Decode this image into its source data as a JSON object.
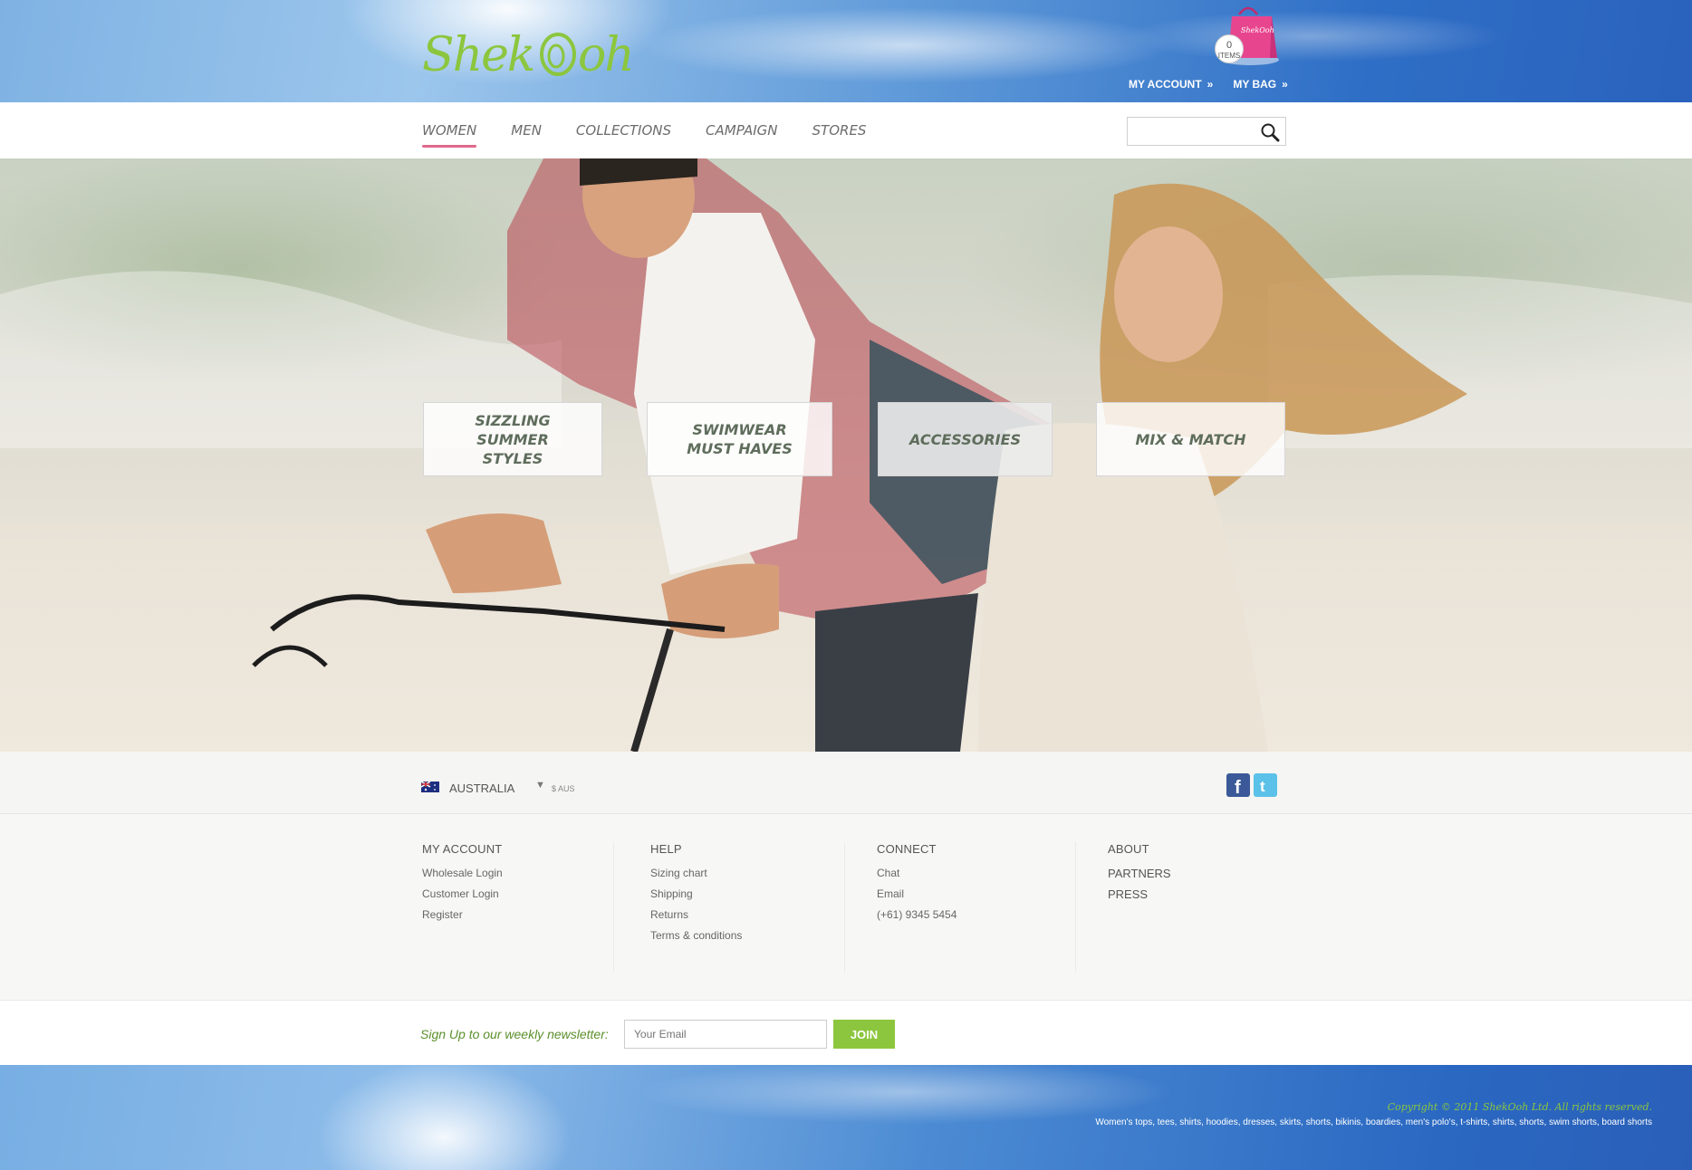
{
  "brand": {
    "logo_text": "ShekOoh"
  },
  "bag": {
    "count": "0",
    "unit": "ITEMS"
  },
  "top_links": {
    "my_account": "MY ACCOUNT",
    "my_bag": "MY BAG",
    "arrow": "»"
  },
  "nav": {
    "items": [
      "WOMEN",
      "MEN",
      "COLLECTIONS",
      "CAMPAIGN",
      "STORES"
    ],
    "active": "WOMEN"
  },
  "search": {
    "placeholder": ""
  },
  "categories": [
    "SIZZLING SUMMER STYLES",
    "SWIMWEAR MUST HAVES",
    "ACCESSORIES",
    "MIX & MATCH"
  ],
  "region": {
    "country": "AUSTRALIA",
    "currency": "$ AUS"
  },
  "footer": {
    "my_account": {
      "title": "MY ACCOUNT",
      "links": [
        "Wholesale Login",
        "Customer Login",
        "Register"
      ]
    },
    "help": {
      "title": "HELP",
      "links": [
        "Sizing chart",
        "Shipping",
        "Returns",
        "Terms & conditions"
      ]
    },
    "connect": {
      "title": "CONNECT",
      "links": [
        "Chat",
        "Email",
        "(+61) 9345 5454"
      ]
    },
    "about": {
      "title": "ABOUT",
      "links": [
        "PARTNERS",
        "PRESS"
      ]
    }
  },
  "newsletter": {
    "label": "Sign Up to our weekly newsletter:",
    "placeholder": "Your Email",
    "button": "JOIN"
  },
  "copyright": "Copyright © 2011 ShekOoh Ltd. All rights reserved.",
  "tagline": "Women's tops, tees, shirts, hoodies, dresses, skirts, shorts, bikinis, boardies, men's polo's, t-shirts, shirts, shorts, swim shorts, board shorts",
  "colors": {
    "accent_green": "#8cc63e",
    "nav_active": "#e06a8c",
    "bag_pink": "#e8458f",
    "sky_blue": "#2f6fc6"
  }
}
